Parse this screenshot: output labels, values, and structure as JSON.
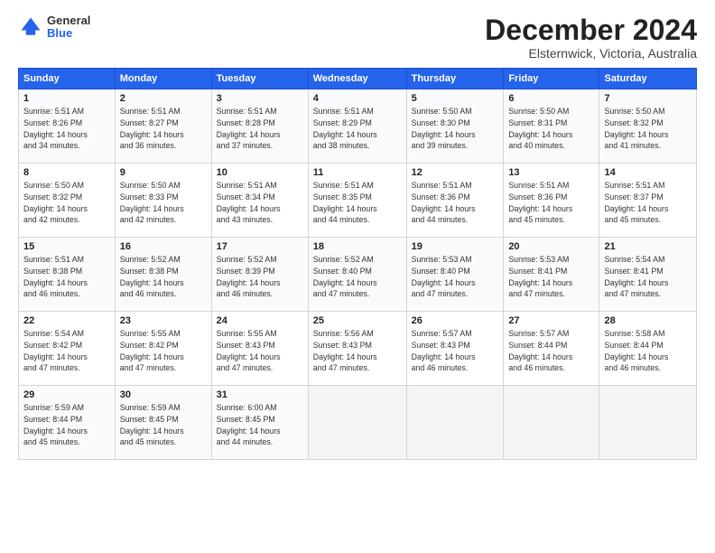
{
  "header": {
    "logo_general": "General",
    "logo_blue": "Blue",
    "month_title": "December 2024",
    "subtitle": "Elsternwick, Victoria, Australia"
  },
  "days_of_week": [
    "Sunday",
    "Monday",
    "Tuesday",
    "Wednesday",
    "Thursday",
    "Friday",
    "Saturday"
  ],
  "weeks": [
    [
      {
        "day": "1",
        "info": "Sunrise: 5:51 AM\nSunset: 8:26 PM\nDaylight: 14 hours\nand 34 minutes."
      },
      {
        "day": "2",
        "info": "Sunrise: 5:51 AM\nSunset: 8:27 PM\nDaylight: 14 hours\nand 36 minutes."
      },
      {
        "day": "3",
        "info": "Sunrise: 5:51 AM\nSunset: 8:28 PM\nDaylight: 14 hours\nand 37 minutes."
      },
      {
        "day": "4",
        "info": "Sunrise: 5:51 AM\nSunset: 8:29 PM\nDaylight: 14 hours\nand 38 minutes."
      },
      {
        "day": "5",
        "info": "Sunrise: 5:50 AM\nSunset: 8:30 PM\nDaylight: 14 hours\nand 39 minutes."
      },
      {
        "day": "6",
        "info": "Sunrise: 5:50 AM\nSunset: 8:31 PM\nDaylight: 14 hours\nand 40 minutes."
      },
      {
        "day": "7",
        "info": "Sunrise: 5:50 AM\nSunset: 8:32 PM\nDaylight: 14 hours\nand 41 minutes."
      }
    ],
    [
      {
        "day": "8",
        "info": "Sunrise: 5:50 AM\nSunset: 8:32 PM\nDaylight: 14 hours\nand 42 minutes."
      },
      {
        "day": "9",
        "info": "Sunrise: 5:50 AM\nSunset: 8:33 PM\nDaylight: 14 hours\nand 42 minutes."
      },
      {
        "day": "10",
        "info": "Sunrise: 5:51 AM\nSunset: 8:34 PM\nDaylight: 14 hours\nand 43 minutes."
      },
      {
        "day": "11",
        "info": "Sunrise: 5:51 AM\nSunset: 8:35 PM\nDaylight: 14 hours\nand 44 minutes."
      },
      {
        "day": "12",
        "info": "Sunrise: 5:51 AM\nSunset: 8:36 PM\nDaylight: 14 hours\nand 44 minutes."
      },
      {
        "day": "13",
        "info": "Sunrise: 5:51 AM\nSunset: 8:36 PM\nDaylight: 14 hours\nand 45 minutes."
      },
      {
        "day": "14",
        "info": "Sunrise: 5:51 AM\nSunset: 8:37 PM\nDaylight: 14 hours\nand 45 minutes."
      }
    ],
    [
      {
        "day": "15",
        "info": "Sunrise: 5:51 AM\nSunset: 8:38 PM\nDaylight: 14 hours\nand 46 minutes."
      },
      {
        "day": "16",
        "info": "Sunrise: 5:52 AM\nSunset: 8:38 PM\nDaylight: 14 hours\nand 46 minutes."
      },
      {
        "day": "17",
        "info": "Sunrise: 5:52 AM\nSunset: 8:39 PM\nDaylight: 14 hours\nand 46 minutes."
      },
      {
        "day": "18",
        "info": "Sunrise: 5:52 AM\nSunset: 8:40 PM\nDaylight: 14 hours\nand 47 minutes."
      },
      {
        "day": "19",
        "info": "Sunrise: 5:53 AM\nSunset: 8:40 PM\nDaylight: 14 hours\nand 47 minutes."
      },
      {
        "day": "20",
        "info": "Sunrise: 5:53 AM\nSunset: 8:41 PM\nDaylight: 14 hours\nand 47 minutes."
      },
      {
        "day": "21",
        "info": "Sunrise: 5:54 AM\nSunset: 8:41 PM\nDaylight: 14 hours\nand 47 minutes."
      }
    ],
    [
      {
        "day": "22",
        "info": "Sunrise: 5:54 AM\nSunset: 8:42 PM\nDaylight: 14 hours\nand 47 minutes."
      },
      {
        "day": "23",
        "info": "Sunrise: 5:55 AM\nSunset: 8:42 PM\nDaylight: 14 hours\nand 47 minutes."
      },
      {
        "day": "24",
        "info": "Sunrise: 5:55 AM\nSunset: 8:43 PM\nDaylight: 14 hours\nand 47 minutes."
      },
      {
        "day": "25",
        "info": "Sunrise: 5:56 AM\nSunset: 8:43 PM\nDaylight: 14 hours\nand 47 minutes."
      },
      {
        "day": "26",
        "info": "Sunrise: 5:57 AM\nSunset: 8:43 PM\nDaylight: 14 hours\nand 46 minutes."
      },
      {
        "day": "27",
        "info": "Sunrise: 5:57 AM\nSunset: 8:44 PM\nDaylight: 14 hours\nand 46 minutes."
      },
      {
        "day": "28",
        "info": "Sunrise: 5:58 AM\nSunset: 8:44 PM\nDaylight: 14 hours\nand 46 minutes."
      }
    ],
    [
      {
        "day": "29",
        "info": "Sunrise: 5:59 AM\nSunset: 8:44 PM\nDaylight: 14 hours\nand 45 minutes."
      },
      {
        "day": "30",
        "info": "Sunrise: 5:59 AM\nSunset: 8:45 PM\nDaylight: 14 hours\nand 45 minutes."
      },
      {
        "day": "31",
        "info": "Sunrise: 6:00 AM\nSunset: 8:45 PM\nDaylight: 14 hours\nand 44 minutes."
      },
      {
        "day": "",
        "info": ""
      },
      {
        "day": "",
        "info": ""
      },
      {
        "day": "",
        "info": ""
      },
      {
        "day": "",
        "info": ""
      }
    ]
  ]
}
